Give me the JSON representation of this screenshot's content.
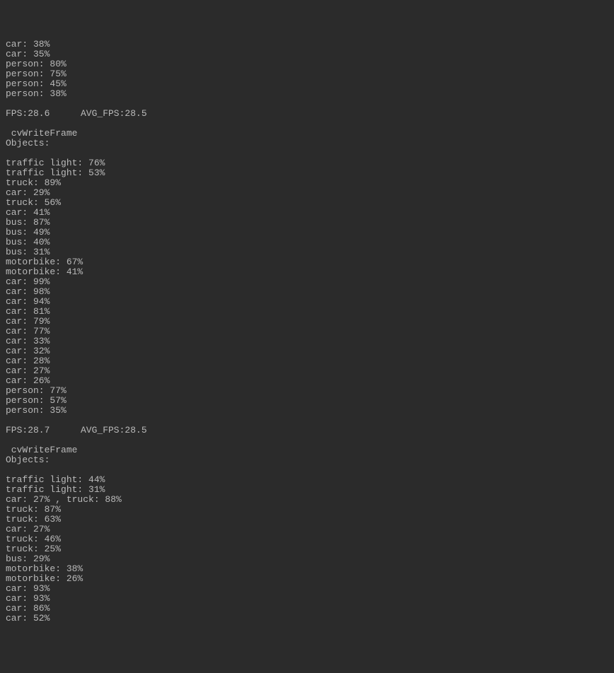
{
  "blocks": [
    {
      "detections": [
        {
          "label": "car",
          "confidence": "38%"
        },
        {
          "label": "car",
          "confidence": "35%"
        },
        {
          "label": "person",
          "confidence": "80%"
        },
        {
          "label": "person",
          "confidence": "75%"
        },
        {
          "label": "person",
          "confidence": "45%"
        },
        {
          "label": "person",
          "confidence": "38%"
        }
      ],
      "fps": "28.6",
      "avg_fps": "28.5"
    },
    {
      "header1": " cvWriteFrame ",
      "header2": "Objects:",
      "detections": [
        {
          "label": "traffic light",
          "confidence": "76%"
        },
        {
          "label": "traffic light",
          "confidence": "53%"
        },
        {
          "label": "truck",
          "confidence": "89%"
        },
        {
          "label": "car",
          "confidence": "29%"
        },
        {
          "label": "truck",
          "confidence": "56%"
        },
        {
          "label": "car",
          "confidence": "41%"
        },
        {
          "label": "bus",
          "confidence": "87%"
        },
        {
          "label": "bus",
          "confidence": "49%"
        },
        {
          "label": "bus",
          "confidence": "40%"
        },
        {
          "label": "bus",
          "confidence": "31%"
        },
        {
          "label": "motorbike",
          "confidence": "67%"
        },
        {
          "label": "motorbike",
          "confidence": "41%"
        },
        {
          "label": "car",
          "confidence": "99%"
        },
        {
          "label": "car",
          "confidence": "98%"
        },
        {
          "label": "car",
          "confidence": "94%"
        },
        {
          "label": "car",
          "confidence": "81%"
        },
        {
          "label": "car",
          "confidence": "79%"
        },
        {
          "label": "car",
          "confidence": "77%"
        },
        {
          "label": "car",
          "confidence": "33%"
        },
        {
          "label": "car",
          "confidence": "32%"
        },
        {
          "label": "car",
          "confidence": "28%"
        },
        {
          "label": "car",
          "confidence": "27%"
        },
        {
          "label": "car",
          "confidence": "26%"
        },
        {
          "label": "person",
          "confidence": "77%"
        },
        {
          "label": "person",
          "confidence": "57%"
        },
        {
          "label": "person",
          "confidence": "35%"
        }
      ],
      "fps": "28.7",
      "avg_fps": "28.5"
    },
    {
      "header1": " cvWriteFrame ",
      "header2": "Objects:",
      "detections": [
        {
          "label": "traffic light",
          "confidence": "44%"
        },
        {
          "label": "traffic light",
          "confidence": "31%"
        },
        {
          "raw": "car: 27% , truck: 88%"
        },
        {
          "label": "truck",
          "confidence": "87%"
        },
        {
          "label": "truck",
          "confidence": "63%"
        },
        {
          "label": "car",
          "confidence": "27%"
        },
        {
          "label": "truck",
          "confidence": "46%"
        },
        {
          "label": "truck",
          "confidence": "25%"
        },
        {
          "label": "bus",
          "confidence": "29%"
        },
        {
          "label": "motorbike",
          "confidence": "38%"
        },
        {
          "label": "motorbike",
          "confidence": "26%"
        },
        {
          "label": "car",
          "confidence": "93%"
        },
        {
          "label": "car",
          "confidence": "93%"
        },
        {
          "label": "car",
          "confidence": "86%"
        },
        {
          "label": "car",
          "confidence": "52%"
        }
      ]
    }
  ],
  "labels": {
    "fps_prefix": "FPS:",
    "avg_fps_prefix": "AVG_FPS:"
  }
}
